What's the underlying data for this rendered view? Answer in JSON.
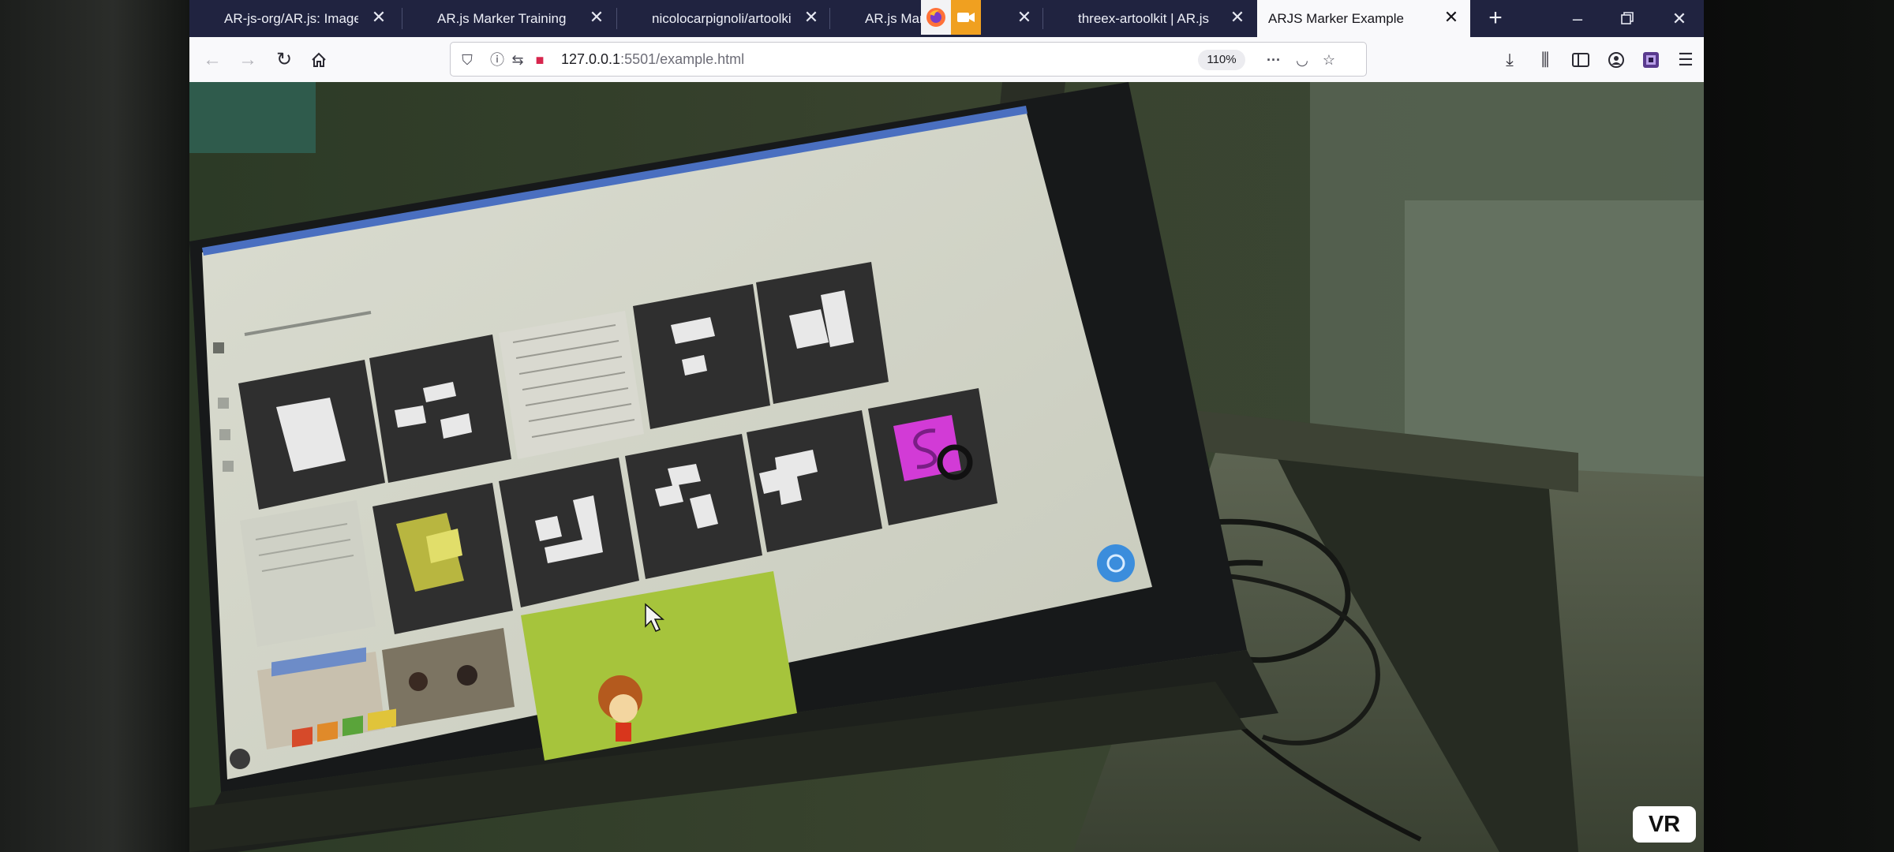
{
  "tabs": [
    {
      "label": "AR-js-org/AR.js: Image t",
      "active": false
    },
    {
      "label": "AR.js Marker Training",
      "active": false
    },
    {
      "label": "nicolocarpignoli/artoolki",
      "active": false
    },
    {
      "label": "AR.js Marker",
      "active": false
    },
    {
      "label": "threex-artoolkit | AR.js",
      "active": false
    },
    {
      "label": "ARJS Marker Example",
      "active": true
    }
  ],
  "address_bar": {
    "host": "127.0.0.1",
    "path": ":5501/example.html",
    "zoom": "110%"
  },
  "icons": {
    "back": "back-arrow-icon",
    "forward": "forward-arrow-icon",
    "reload": "reload-icon",
    "home": "home-icon",
    "tracking": "tracking-protection-icon",
    "info": "site-info-icon",
    "permissions": "permissions-icon",
    "camera": "camera-sharing-icon",
    "more": "more-actions-icon",
    "pocket": "pocket-icon",
    "bookmark": "bookmark-star-icon",
    "downloads": "downloads-icon",
    "library": "library-icon",
    "sidebar": "sidebar-icon",
    "account": "account-icon",
    "extension": "extension-icon",
    "menu": "hamburger-menu-icon"
  },
  "viewer": {
    "vr_label": "VR"
  },
  "colors": {
    "tabbar": "#202340",
    "navbar": "#f9f9fb",
    "scene_green": "#26301f",
    "marker_yellow": "#b8b640",
    "marker_magenta": "#d23bd6",
    "card_lime": "#a6c43c"
  }
}
